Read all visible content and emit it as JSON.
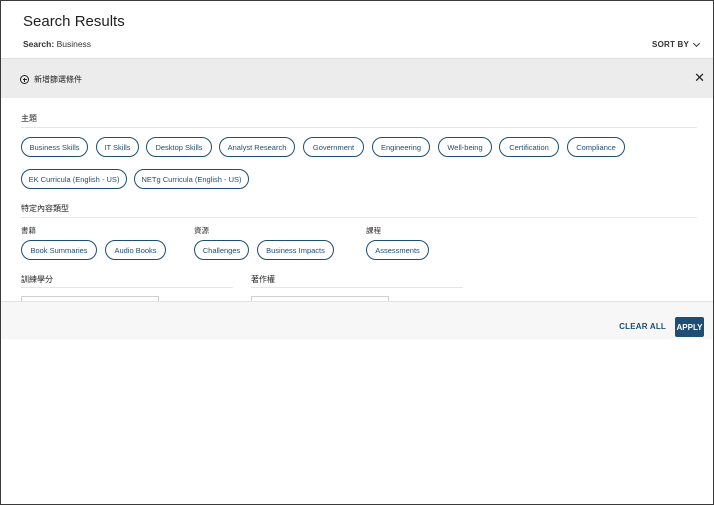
{
  "header": {
    "title": "Search Results",
    "search_label": "Search:",
    "search_value": "Business",
    "sort_label": "SORT BY"
  },
  "filter_header": {
    "add_filter_label": "新增篩選條件",
    "close_icon": "close-icon"
  },
  "topics": {
    "label": "主題",
    "chips": [
      "Business Skills",
      "IT Skills",
      "Desktop Skills",
      "Analyst Research",
      "Government",
      "Engineering",
      "Well-being",
      "Certification",
      "Compliance",
      "EK Curricula (English - US)",
      "NETg Curricula (English - US)"
    ]
  },
  "content_types": {
    "label": "特定內容類型",
    "books": {
      "label": "書籍",
      "chips": [
        "Book Summaries",
        "Audio Books"
      ]
    },
    "resources": {
      "label": "資源",
      "chips": [
        "Challenges",
        "Business Impacts"
      ]
    },
    "courses": {
      "label": "課程",
      "chips": [
        "Assessments"
      ]
    }
  },
  "training_credits": {
    "label": "訓練學分"
  },
  "copyright": {
    "label": "著作權"
  },
  "footer": {
    "clear_all_label": "CLEAR ALL",
    "apply_label": "APPLY"
  },
  "colors": {
    "accent": "#1e4e74",
    "panel": "#ececec"
  }
}
